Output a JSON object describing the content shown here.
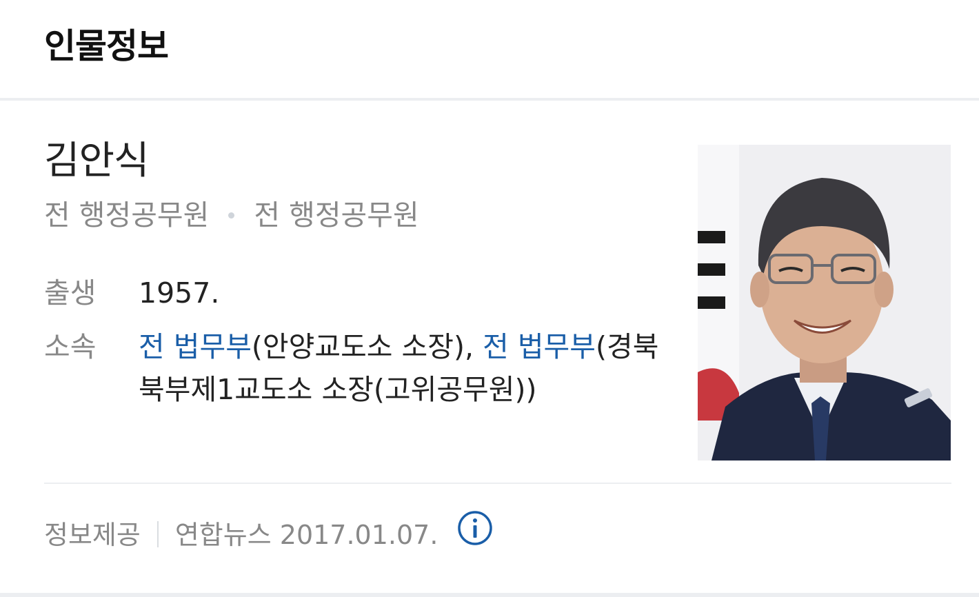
{
  "section": {
    "title": "인물정보"
  },
  "person": {
    "name": "김안식",
    "jobs": [
      "전 행정공무원",
      "전 행정공무원"
    ],
    "photo_alt": "김안식 인물 사진"
  },
  "info": {
    "birth": {
      "label": "출생",
      "value": "1957."
    },
    "affiliation": {
      "label": "소속",
      "link1": "전 법무부",
      "text1": "(안양교도소 소장), ",
      "link2": "전 법무부",
      "text2": "(경북북부제1교도소 소장(고위공무원))"
    }
  },
  "footer": {
    "label": "정보제공",
    "source": "연합뉴스 2017.01.07.",
    "info_icon": "info-circle-icon"
  },
  "colors": {
    "link": "#1a5ea8",
    "muted": "#888888",
    "text": "#222222",
    "separator": "#eceef1"
  }
}
